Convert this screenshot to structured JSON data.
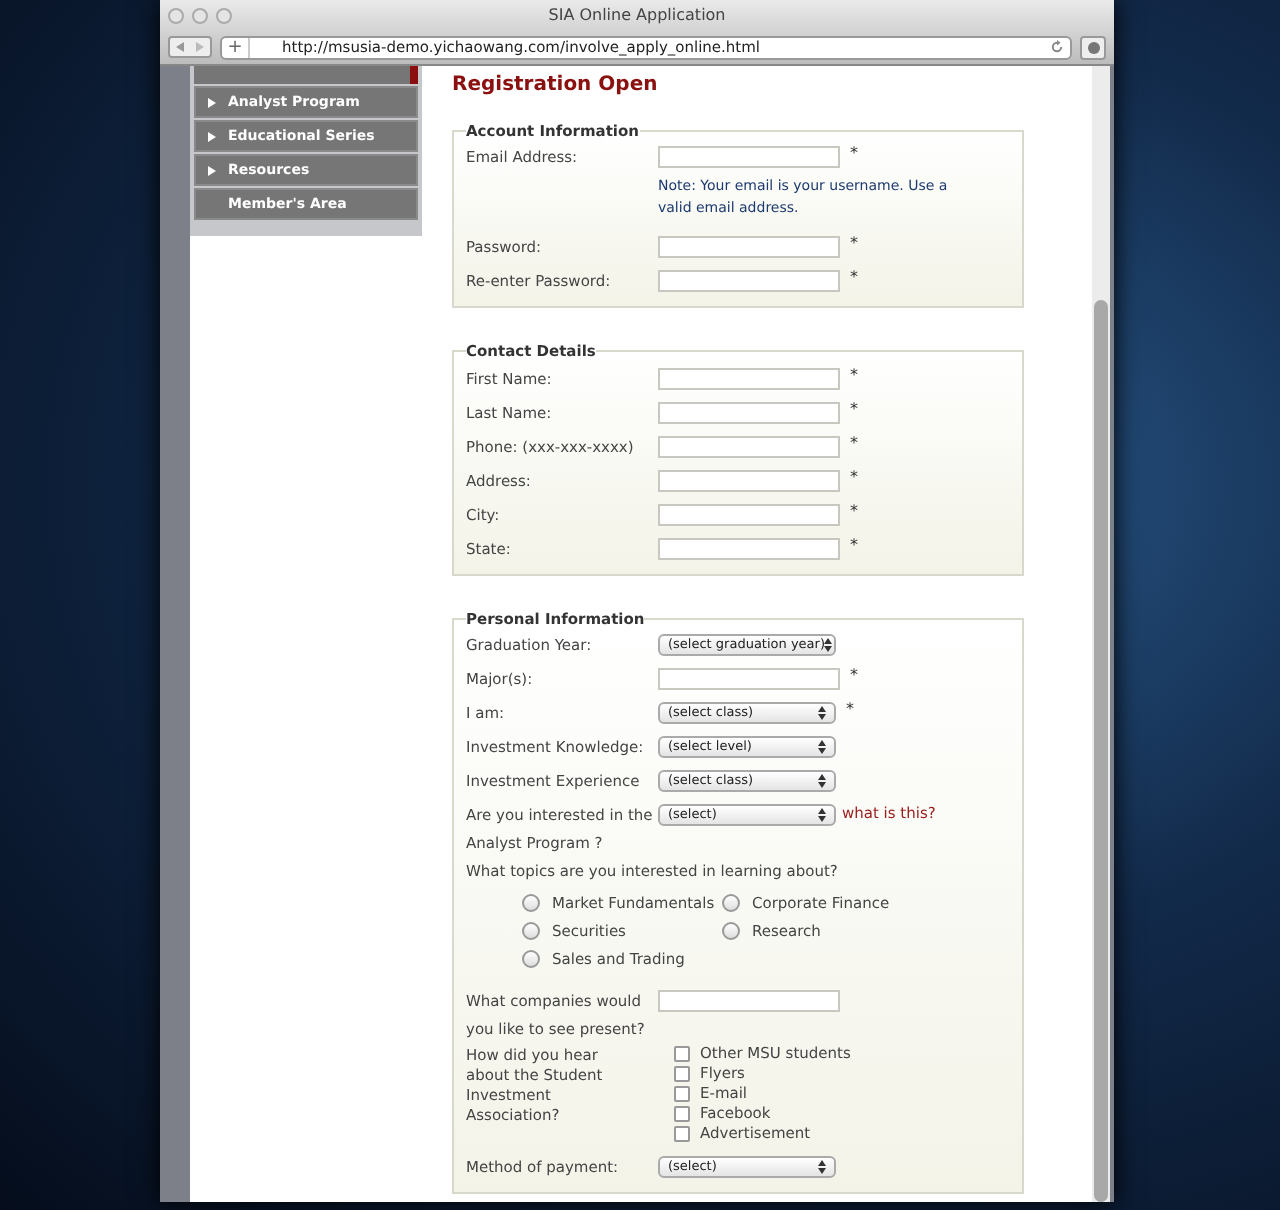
{
  "window": {
    "title": "SIA Online Application"
  },
  "toolbar": {
    "url": "http://msusia-demo.yichaowang.com/involve_apply_online.html",
    "add_label": "+"
  },
  "sidebar": {
    "items": [
      {
        "label": "Analyst Program",
        "arrow": true
      },
      {
        "label": "Educational Series",
        "arrow": true
      },
      {
        "label": "Resources",
        "arrow": true
      },
      {
        "label": "Member's Area",
        "arrow": false
      }
    ]
  },
  "heading": "Registration Open",
  "sections": [
    {
      "legend": "Account Information",
      "fields": [
        {
          "kind": "text",
          "label": "Email Address:",
          "mark": "*",
          "note": "Note: Your email is your username. Use a valid email address."
        },
        {
          "kind": "text",
          "label": "Password:",
          "mark": "*"
        },
        {
          "kind": "text",
          "label": "Re-enter Password:",
          "mark": "*"
        }
      ]
    },
    {
      "legend": "Contact Details",
      "fields": [
        {
          "kind": "text",
          "label": "First Name:",
          "mark": "*"
        },
        {
          "kind": "text",
          "label": "Last Name:",
          "mark": "*"
        },
        {
          "kind": "text",
          "label": "Phone: (xxx-xxx-xxxx)",
          "mark": "*"
        },
        {
          "kind": "text",
          "label": "Address:",
          "mark": "*"
        },
        {
          "kind": "text",
          "label": "City:",
          "mark": "*"
        },
        {
          "kind": "text",
          "label": "State:",
          "mark": "*"
        }
      ]
    },
    {
      "legend": "Personal Information",
      "fields": [
        {
          "kind": "select",
          "label": "Graduation Year:",
          "value": "(select graduation year)"
        },
        {
          "kind": "text",
          "label": "Major(s):",
          "mark": "*"
        },
        {
          "kind": "select",
          "label": "I am:",
          "value": "(select class)",
          "mark": "*"
        },
        {
          "kind": "select",
          "label": "Investment Knowledge:",
          "value": "(select level)"
        },
        {
          "kind": "select",
          "label": "Investment Experience",
          "value": "(select class)"
        },
        {
          "kind": "select",
          "label": "Are you interested in the Analyst Program ?",
          "value": "(select)",
          "link": "what is this?"
        },
        {
          "kind": "radio_group",
          "label": "What topics are you interested in learning about?",
          "options": [
            {
              "label": "Market Fundamentals",
              "selected": false
            },
            {
              "label": "Corporate Finance",
              "selected": false
            },
            {
              "label": "Securities",
              "selected": false
            },
            {
              "label": "Research",
              "selected": false
            },
            {
              "label": "Sales and Trading",
              "selected": false
            }
          ]
        },
        {
          "kind": "text",
          "label": "What companies would you like to see present?"
        },
        {
          "kind": "checkbox_group",
          "label": "How did you hear about the Student Investment Association?",
          "options": [
            {
              "label": "Other MSU students",
              "checked": false
            },
            {
              "label": "Flyers",
              "checked": false
            },
            {
              "label": "E-mail",
              "checked": false
            },
            {
              "label": "Facebook",
              "checked": false
            },
            {
              "label": "Advertisement",
              "checked": false
            }
          ]
        },
        {
          "kind": "select",
          "label": "Method of payment:",
          "value": "(select)"
        }
      ]
    }
  ]
}
